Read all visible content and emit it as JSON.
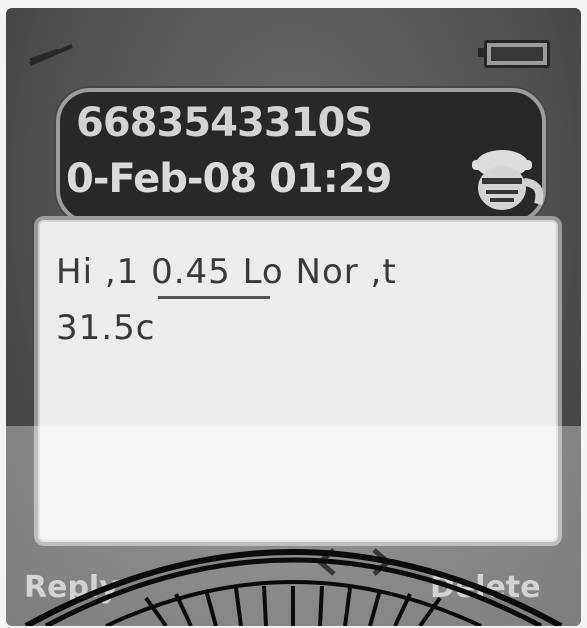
{
  "status_bar": {
    "signal_icon": "signal-strength-icon",
    "battery_icon": "battery-icon"
  },
  "header": {
    "sender_number": "6683543310S",
    "timestamp": "0-Feb-08 01:29",
    "contact_icon": "contact-face-icon"
  },
  "message": {
    "line1": "Hi ,1 0.45 Lo Nor ,t",
    "line2": "31.5c"
  },
  "softkeys": {
    "left_label": "Reply",
    "right_label": "Delete"
  },
  "watermark": "emblem-seal"
}
